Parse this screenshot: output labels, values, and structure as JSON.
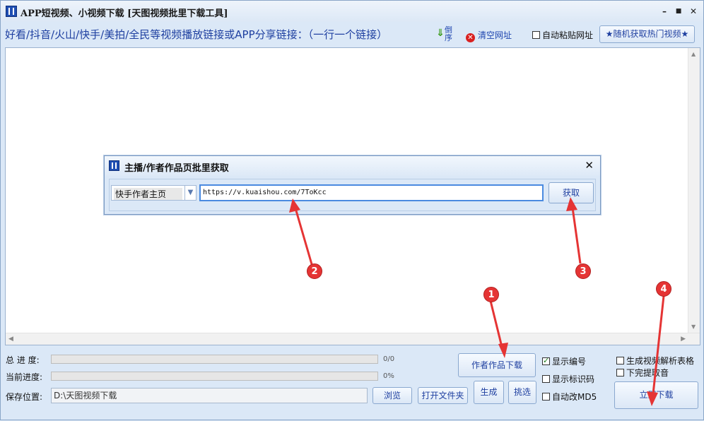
{
  "window": {
    "title": "APP短视频、小视频下载 [天图视频批里下载工具]",
    "controls": {
      "minimize": "–",
      "maximize": "■",
      "close": "✕"
    }
  },
  "toolbar": {
    "instruction": "好看/抖音/火山/快手/美拍/全民等视频播放链接或APP分享链接：（一行一个链接）",
    "reverse_label": "倒序",
    "clear_label": "清空网址",
    "auto_paste_label": "自动粘贴网址",
    "auto_paste_checked": false,
    "random_label": "★随机获取热门视频★"
  },
  "url_box": {
    "content": ""
  },
  "dialog": {
    "title": "主播/作者作品页批里获取",
    "close": "✕",
    "source_select": "快手作者主页",
    "url_value": "https://v.kuaishou.com/7ToKcc",
    "fetch_label": "获取"
  },
  "progress": {
    "total_label": "总 进 度:",
    "total_value": "0/0",
    "total_fraction": 0,
    "current_label": "当前进度:",
    "current_value": "0%",
    "current_fraction": 0
  },
  "save": {
    "label": "保存位置:",
    "path": "D:\\天图视频下载",
    "browse_label": "浏览",
    "open_folder_label": "打开文件夹"
  },
  "actions": {
    "author_download_label": "作者作品下载",
    "generate_label": "生成",
    "pick_label": "挑选",
    "download_now_label": "立即下载"
  },
  "options": {
    "show_number": {
      "label": "显示编号",
      "checked": true
    },
    "show_id": {
      "label": "显示标识码",
      "checked": false
    },
    "auto_md5": {
      "label": "自动改MD5",
      "checked": false
    },
    "gen_table": {
      "label": "生成视频解析表格",
      "checked": false
    },
    "extract_audio": {
      "label": "下完提取音",
      "checked": false
    }
  },
  "annotations": {
    "markers": [
      "1",
      "2",
      "3",
      "4"
    ],
    "color": "#e53434"
  }
}
